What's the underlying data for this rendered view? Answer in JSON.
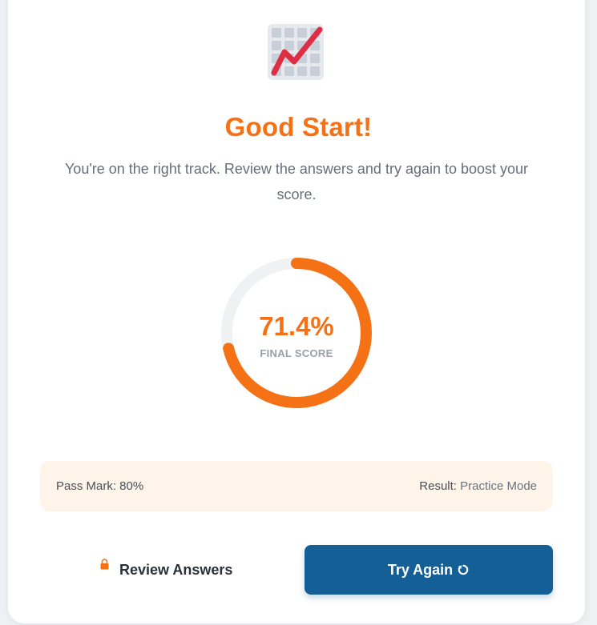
{
  "header": {
    "icon": "chart-increasing-icon",
    "title": "Good Start!",
    "subtitle": "You're on the right track. Review the answers and try again to boost your score."
  },
  "score": {
    "value_text": "71.4%",
    "value": 71.4,
    "label": "FINAL SCORE"
  },
  "info": {
    "pass_mark": "Pass Mark: 80%",
    "result_label": "Result:",
    "result_value": "Practice Mode"
  },
  "actions": {
    "review_label": "Review Answers",
    "review_icon": "lock-icon",
    "try_again_label": "Try Again",
    "try_again_icon": "retry-icon"
  },
  "colors": {
    "accent": "#f47116",
    "primary_button": "#135f96",
    "track": "#f0f1f3",
    "info_bg": "#fff4ea"
  }
}
